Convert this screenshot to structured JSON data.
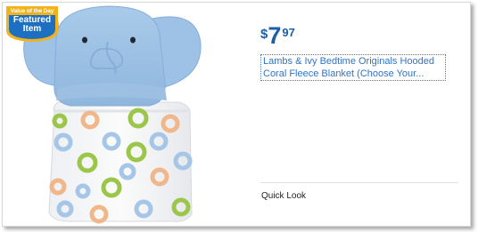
{
  "badge": {
    "top_text": "Value of the Day",
    "main_text": "Featured Item",
    "colors": {
      "outer": "#f2b21b",
      "inner": "#1d6fc2"
    }
  },
  "product": {
    "image": "hooded-elephant-blanket",
    "price": {
      "currency": "$",
      "dollars": "7",
      "cents": "97",
      "color": "#1a5fa8"
    },
    "title_line1": "Lambs & Ivy Bedtime Originals Hooded",
    "title_line2": "Coral Fleece Blanket (Choose Your...",
    "link_color": "#2f73c7"
  },
  "actions": {
    "quick_look": "Quick Look"
  }
}
